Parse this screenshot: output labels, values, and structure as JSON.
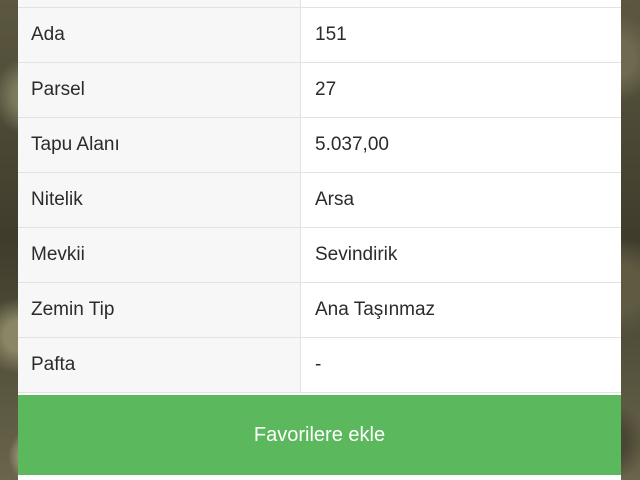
{
  "details": {
    "rows": [
      {
        "label": "Ada",
        "value": "151"
      },
      {
        "label": "Parsel",
        "value": "27"
      },
      {
        "label": "Tapu Alanı",
        "value": "5.037,00"
      },
      {
        "label": "Nitelik",
        "value": "Arsa"
      },
      {
        "label": "Mevkii",
        "value": "Sevindirik"
      },
      {
        "label": "Zemin Tip",
        "value": "Ana Taşınmaz"
      },
      {
        "label": "Pafta",
        "value": "-"
      }
    ]
  },
  "actions": {
    "favorite_label": "Favorilere ekle"
  },
  "colors": {
    "button_green": "#5cb85c",
    "label_bg": "#f7f7f7",
    "text": "#2b2b2b"
  }
}
